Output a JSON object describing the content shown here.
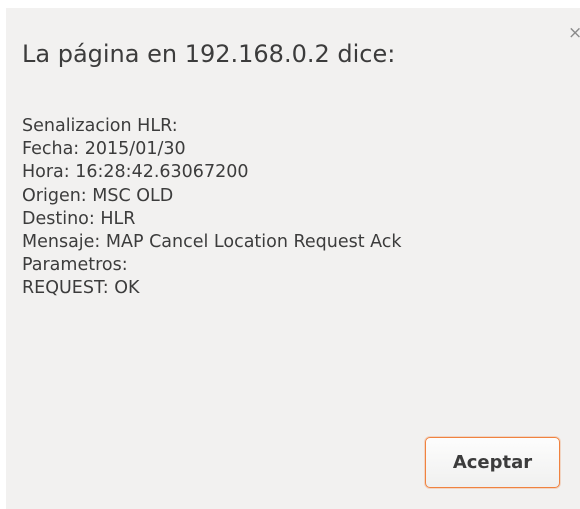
{
  "dialog": {
    "title": "La página en 192.168.0.2 dice:",
    "close_glyph": "×",
    "message_lines": [
      "Senalizacion HLR:",
      "Fecha: 2015/01/30",
      "Hora: 16:28:42.63067200",
      "Origen: MSC OLD",
      "Destino: HLR",
      "Mensaje: MAP Cancel Location Request Ack",
      "Parametros:",
      "REQUEST: OK"
    ],
    "ok_label": "Aceptar"
  },
  "colors": {
    "dialog_background": "#f2f1f0",
    "text": "#3c3c3c",
    "button_focus_border": "#f0823f"
  }
}
